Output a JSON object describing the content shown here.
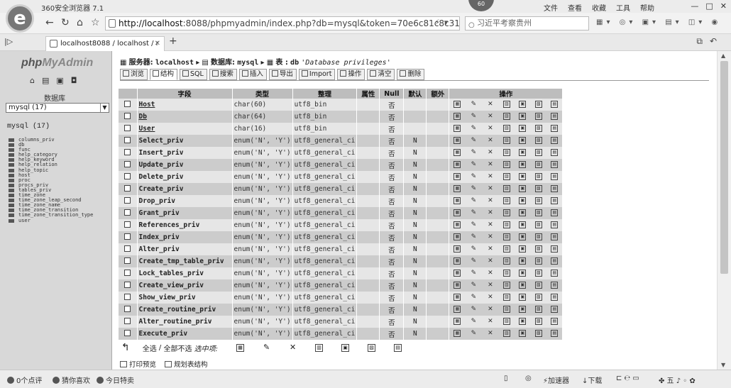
{
  "browser": {
    "name": "360安全浏览器 7.1",
    "badge": "60",
    "menu": [
      "文件",
      "查看",
      "收藏",
      "工具",
      "帮助"
    ],
    "window_controls": [
      "—",
      "□",
      "✕"
    ],
    "url_host": "http://localhost",
    "url_rest": ":8088/phpmyadmin/index.php?db=mysql&token=70e6c81c8c31",
    "search_placeholder": "习近平考察贵州",
    "tab_title": "localhost8088 / localhost / r",
    "nav": {
      "back": "←",
      "reload": "↻",
      "home": "⌂",
      "star": "☆"
    }
  },
  "sidebar": {
    "logo_a": "php",
    "logo_b": "MyAdmin",
    "db_label": "数据库",
    "db_select": "mysql (17)",
    "db_heading": "mysql (17)",
    "tables": [
      "columns_priv",
      "db",
      "func",
      "help_category",
      "help_keyword",
      "help_relation",
      "help_topic",
      "host",
      "proc",
      "procs_priv",
      "tables_priv",
      "time_zone",
      "time_zone_leap_second",
      "time_zone_name",
      "time_zone_transition",
      "time_zone_transition_type",
      "user"
    ]
  },
  "breadcrumb": {
    "server_label": "服务器:",
    "server_value": "localhost",
    "db_label": "数据库:",
    "db_value": "mysql",
    "table_label": "表 :",
    "table_value": "db",
    "comment": "'Database privileges'"
  },
  "tabs": [
    "浏览",
    "结构",
    "SQL",
    "搜索",
    "插入",
    "导出",
    "Import",
    "操作",
    "清空",
    "删除"
  ],
  "table": {
    "headers": [
      "字段",
      "类型",
      "整理",
      "属性",
      "Null",
      "默认",
      "额外",
      "操作"
    ],
    "rows": [
      {
        "name": "Host",
        "type": "char(60)",
        "coll": "utf8_bin",
        "null": "否",
        "default": ""
      },
      {
        "name": "Db",
        "type": "char(64)",
        "coll": "utf8_bin",
        "null": "否",
        "default": ""
      },
      {
        "name": "User",
        "type": "char(16)",
        "coll": "utf8_bin",
        "null": "否",
        "default": ""
      },
      {
        "name": "Select_priv",
        "type": "enum('N', 'Y')",
        "coll": "utf8_general_ci",
        "null": "否",
        "default": "N"
      },
      {
        "name": "Insert_priv",
        "type": "enum('N', 'Y')",
        "coll": "utf8_general_ci",
        "null": "否",
        "default": "N"
      },
      {
        "name": "Update_priv",
        "type": "enum('N', 'Y')",
        "coll": "utf8_general_ci",
        "null": "否",
        "default": "N"
      },
      {
        "name": "Delete_priv",
        "type": "enum('N', 'Y')",
        "coll": "utf8_general_ci",
        "null": "否",
        "default": "N"
      },
      {
        "name": "Create_priv",
        "type": "enum('N', 'Y')",
        "coll": "utf8_general_ci",
        "null": "否",
        "default": "N"
      },
      {
        "name": "Drop_priv",
        "type": "enum('N', 'Y')",
        "coll": "utf8_general_ci",
        "null": "否",
        "default": "N"
      },
      {
        "name": "Grant_priv",
        "type": "enum('N', 'Y')",
        "coll": "utf8_general_ci",
        "null": "否",
        "default": "N"
      },
      {
        "name": "References_priv",
        "type": "enum('N', 'Y')",
        "coll": "utf8_general_ci",
        "null": "否",
        "default": "N"
      },
      {
        "name": "Index_priv",
        "type": "enum('N', 'Y')",
        "coll": "utf8_general_ci",
        "null": "否",
        "default": "N"
      },
      {
        "name": "Alter_priv",
        "type": "enum('N', 'Y')",
        "coll": "utf8_general_ci",
        "null": "否",
        "default": "N"
      },
      {
        "name": "Create_tmp_table_priv",
        "type": "enum('N', 'Y')",
        "coll": "utf8_general_ci",
        "null": "否",
        "default": "N"
      },
      {
        "name": "Lock_tables_priv",
        "type": "enum('N', 'Y')",
        "coll": "utf8_general_ci",
        "null": "否",
        "default": "N"
      },
      {
        "name": "Create_view_priv",
        "type": "enum('N', 'Y')",
        "coll": "utf8_general_ci",
        "null": "否",
        "default": "N"
      },
      {
        "name": "Show_view_priv",
        "type": "enum('N', 'Y')",
        "coll": "utf8_general_ci",
        "null": "否",
        "default": "N"
      },
      {
        "name": "Create_routine_priv",
        "type": "enum('N', 'Y')",
        "coll": "utf8_general_ci",
        "null": "否",
        "default": "N"
      },
      {
        "name": "Alter_routine_priv",
        "type": "enum('N', 'Y')",
        "coll": "utf8_general_ci",
        "null": "否",
        "default": "N"
      },
      {
        "name": "Execute_priv",
        "type": "enum('N', 'Y')",
        "coll": "utf8_general_ci",
        "null": "否",
        "default": "N"
      }
    ],
    "action_icons": [
      "browse-distinct-icon",
      "edit-icon",
      "drop-icon",
      "primary-icon",
      "unique-icon",
      "index-icon",
      "fulltext-icon"
    ]
  },
  "bulk": {
    "check_all": "全选",
    "separator": "/",
    "uncheck_all": "全部不选",
    "with_selected": "选中项:"
  },
  "print": {
    "print_view": "打印预览",
    "propose": "规划表结构"
  },
  "statusbar": {
    "left1": "0个点评",
    "left2": "猜你喜欢",
    "left3": "今日特卖",
    "accelerator": "加速器",
    "download": "下载"
  }
}
